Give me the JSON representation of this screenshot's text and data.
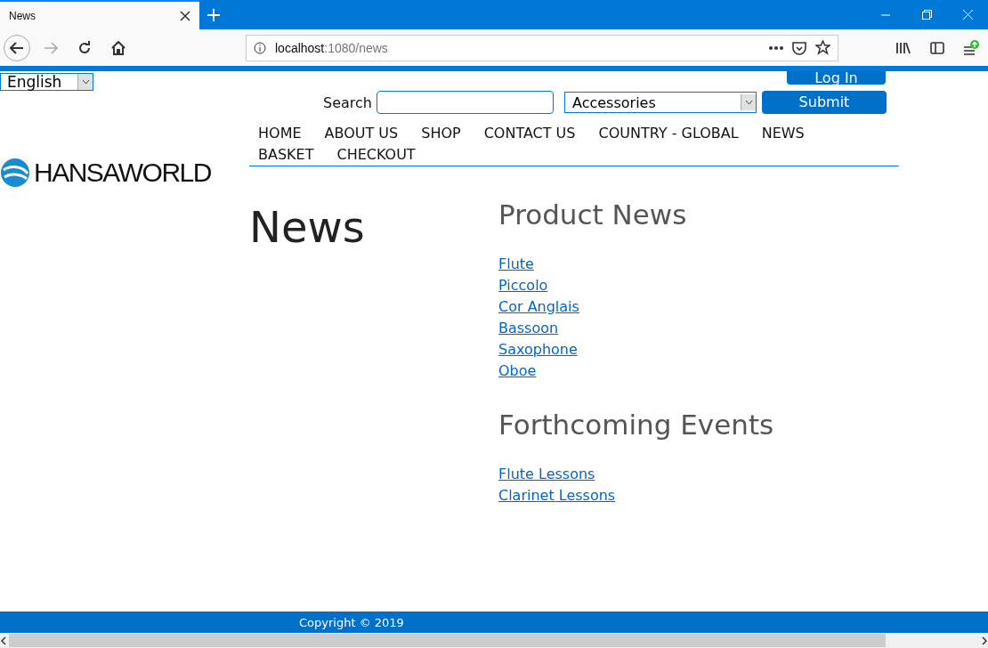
{
  "browser": {
    "tab_title": "News",
    "url_host": "localhost",
    "url_path": ":1080/news"
  },
  "language_select": {
    "value": "English"
  },
  "login_button": "Log In",
  "search": {
    "label": "Search",
    "category": "Accessories",
    "submit": "Submit"
  },
  "logo": {
    "text": "HANSAWORLD"
  },
  "nav": [
    "HOME",
    "ABOUT US",
    "SHOP",
    "CONTACT US",
    "COUNTRY - GLOBAL",
    "NEWS",
    "BASKET",
    "CHECKOUT"
  ],
  "page_title": "News",
  "sections": [
    {
      "heading": "Product News",
      "links": [
        "Flute",
        "Piccolo",
        "Cor Anglais",
        "Bassoon",
        "Saxophone",
        "Oboe"
      ]
    },
    {
      "heading": "Forthcoming Events",
      "links": [
        "Flute Lessons",
        "Clarinet Lessons"
      ]
    }
  ],
  "footer": "Copyright © 2019"
}
